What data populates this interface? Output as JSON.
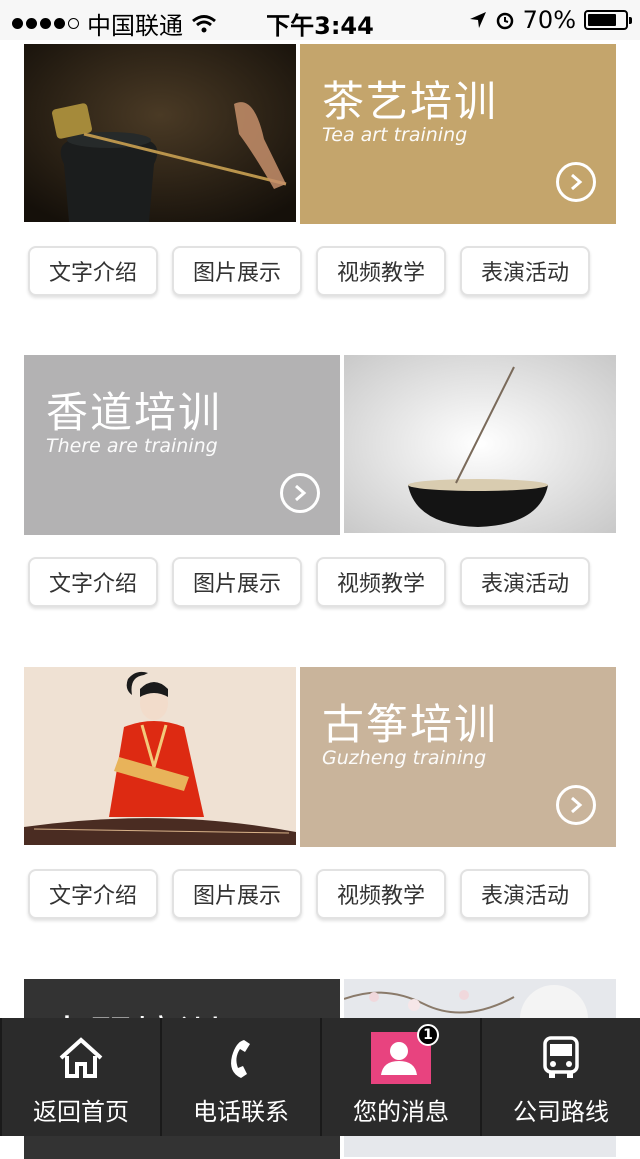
{
  "status_bar": {
    "carrier": "中国联通",
    "time": "下午3:44",
    "battery": "70%"
  },
  "sections": [
    {
      "title_cn": "茶艺培训",
      "title_en": "Tea art training",
      "color": "#c4a56c",
      "buttons": [
        "文字介绍",
        "图片展示",
        "视频教学",
        "表演活动"
      ]
    },
    {
      "title_cn": "香道培训",
      "title_en": "There are training",
      "color": "#b3b2b3",
      "buttons": [
        "文字介绍",
        "图片展示",
        "视频教学",
        "表演活动"
      ]
    },
    {
      "title_cn": "古筝培训",
      "title_en": "Guzheng training",
      "color": "#c9b49b",
      "buttons": [
        "文字介绍",
        "图片展示",
        "视频教学",
        "表演活动"
      ]
    },
    {
      "title_cn": "古琴培训",
      "color": "#333333"
    }
  ],
  "tabbar": {
    "items": [
      {
        "label": "返回首页",
        "icon": "home-icon"
      },
      {
        "label": "电话联系",
        "icon": "phone-icon"
      },
      {
        "label": "您的消息",
        "icon": "user-message-icon",
        "badge": "1"
      },
      {
        "label": "公司路线",
        "icon": "bus-icon"
      }
    ]
  }
}
